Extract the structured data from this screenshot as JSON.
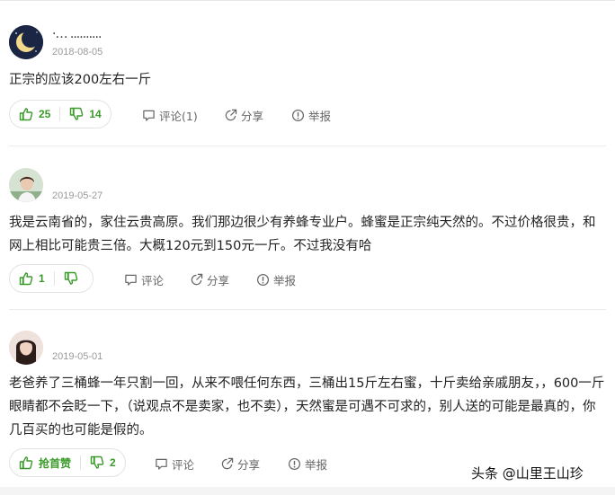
{
  "comments": [
    {
      "username": "·… ..........",
      "date": "2018-08-05",
      "text": "正宗的应该200左右一斤",
      "likes": "25",
      "dislikes": "14",
      "comment_label": "评论(1)",
      "share_label": "分享",
      "report_label": "举报"
    },
    {
      "username": "",
      "date": "2019-05-27",
      "text": "我是云南省的，家住云贵高原。我们那边很少有养蜂专业户。蜂蜜是正宗纯天然的。不过价格很贵，和网上相比可能贵三倍。大概120元到150元一斤。不过我没有哈",
      "likes": "1",
      "dislikes": "",
      "comment_label": "评论",
      "share_label": "分享",
      "report_label": "举报"
    },
    {
      "username": "",
      "date": "2019-05-01",
      "text": "老爸养了三桶蜂一年只割一回，从来不喂任何东西，三桶出15斤左右蜜，十斤卖给亲戚朋友，，600一斤眼睛都不会眨一下，（说观点不是卖家，也不卖），天然蜜是可遇不可求的，别人送的可能是最真的，你几百买的也可能是假的。",
      "likes": "抢首赞",
      "dislikes": "2",
      "comment_label": "评论",
      "share_label": "分享",
      "report_label": "举报"
    }
  ],
  "watermark": "头条 @山里王山珍",
  "colors": {
    "accent": "#3a9a2a",
    "muted": "#9a9a9a",
    "icon": "#666666"
  },
  "icons": [
    "moon-avatar",
    "thumb-up-icon",
    "thumb-down-icon",
    "comment-icon",
    "share-icon",
    "report-icon"
  ]
}
